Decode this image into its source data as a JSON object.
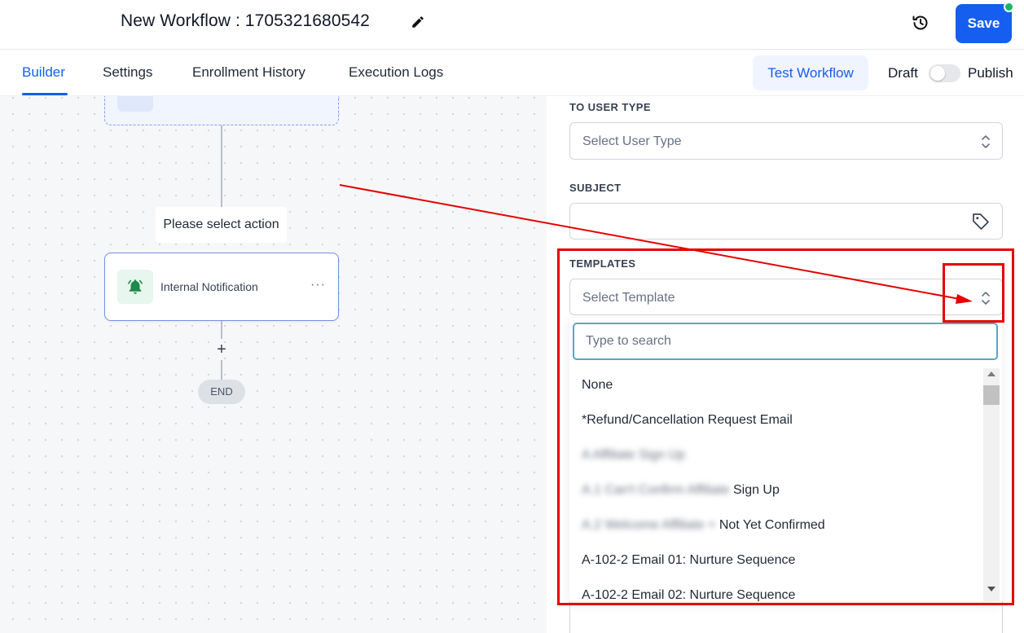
{
  "header": {
    "workflow_title": "New Workflow : 1705321680542",
    "save_label": "Save"
  },
  "tabs": {
    "items": [
      {
        "label": "Builder",
        "active": true
      },
      {
        "label": "Settings",
        "active": false
      },
      {
        "label": "Enrollment History",
        "active": false
      },
      {
        "label": "Execution Logs",
        "active": false
      }
    ],
    "test_workflow_label": "Test Workflow",
    "draft_label": "Draft",
    "publish_label": "Publish",
    "publish_toggle_on": false
  },
  "canvas": {
    "action_placeholder": "Please select action",
    "action_node_label": "Internal Notification",
    "action_node_menu": "···",
    "add_step": "+",
    "end_label": "END"
  },
  "panel": {
    "to_user_type": {
      "label": "TO USER TYPE",
      "placeholder": "Select User Type"
    },
    "subject": {
      "label": "SUBJECT",
      "value": ""
    },
    "templates": {
      "label": "TEMPLATES",
      "placeholder": "Select Template",
      "search_placeholder": "Type to search",
      "options": [
        {
          "text": "None",
          "obscured": false
        },
        {
          "text": "*Refund/Cancellation Request Email",
          "obscured": false
        },
        {
          "text": "A Affiliate Sign Up",
          "obscured": true
        },
        {
          "text": "A.1 Can't Confirm Affiliate",
          "obscured": true,
          "visible_tail": " Sign Up"
        },
        {
          "text": "A.2 Welcome Affiliate +",
          "obscured": true,
          "visible_tail": " Not Yet Confirmed"
        },
        {
          "text": "A-102-2 Email 01: Nurture Sequence",
          "obscured": false
        },
        {
          "text": "A-102-2 Email 02: Nurture Sequence",
          "obscured": false
        }
      ]
    }
  },
  "colors": {
    "primary": "#155eef",
    "annotation": "#e60000",
    "status_dot": "#12b76a",
    "bell": "#1f8a4c"
  }
}
